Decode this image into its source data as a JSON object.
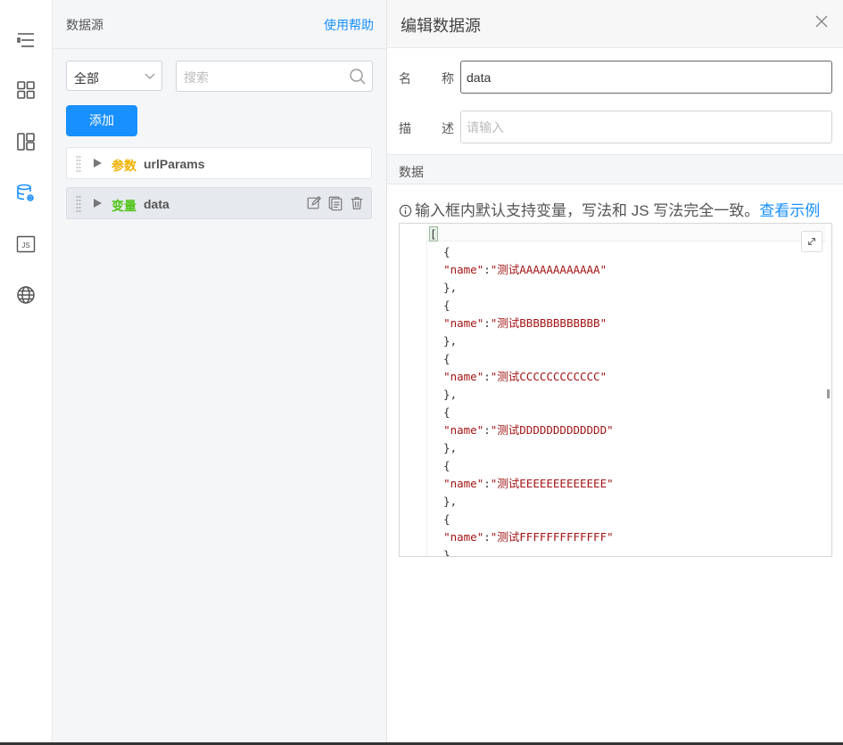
{
  "rail": {
    "icons": [
      "outline-icon",
      "components-icon",
      "layout-icon",
      "datasource-icon",
      "js-icon",
      "globe-icon"
    ],
    "js_label": "JS",
    "active_index": 3,
    "accent": "#1890ff"
  },
  "middle": {
    "title": "数据源",
    "help": "使用帮助",
    "filter_value": "全部",
    "search_placeholder": "搜索",
    "add_label": "添加",
    "items": [
      {
        "kind": "参数",
        "name": "urlParams",
        "kind_color": "#f0b000",
        "active": false
      },
      {
        "kind": "变量",
        "name": "data",
        "kind_color": "#52c41a",
        "active": true
      }
    ]
  },
  "editor_panel": {
    "title": "编辑数据源",
    "name_label_1": "名",
    "name_label_2": "称",
    "name_value": "data",
    "desc_label_1": "描",
    "desc_label_2": "述",
    "desc_placeholder": "请输入",
    "section_title": "数据",
    "tip_text": "输入框内默认支持变量，写法和 JS 写法完全一致。",
    "tip_link": "查看示例",
    "code_lines": [
      "[",
      "  {",
      "  \"name\":\"测试AAAAAAAAAAAA\"",
      "  },",
      "  {",
      "  \"name\":\"测试BBBBBBBBBBBB\"",
      "  },",
      "  {",
      "  \"name\":\"测试CCCCCCCCCCCC\"",
      "  },",
      "  {",
      "  \"name\":\"测试DDDDDDDDDDDDD\"",
      "  },",
      "  {",
      "  \"name\":\"测试EEEEEEEEEEEEE\"",
      "  },",
      "  {",
      "  \"name\":\"测试FFFFFFFFFFFFF\"",
      "  }"
    ]
  }
}
